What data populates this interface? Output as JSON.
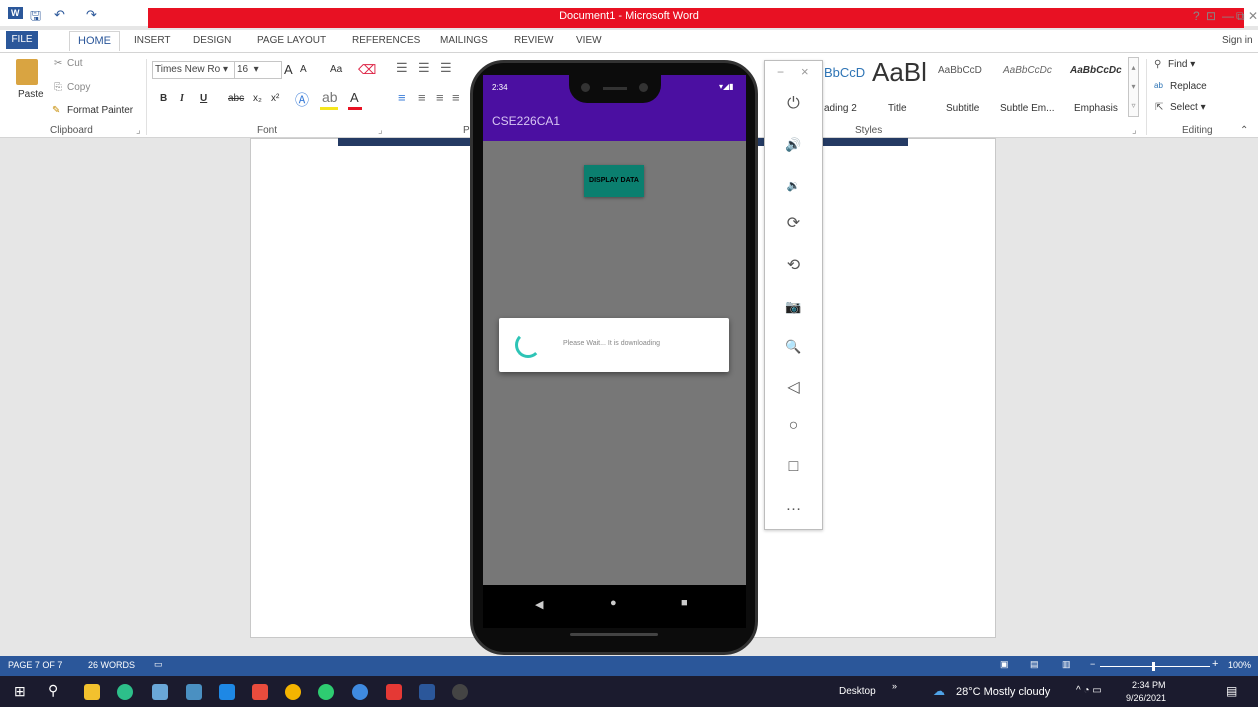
{
  "window": {
    "title": "Document1 - Microsoft Word",
    "controls": [
      "?",
      "⊡",
      "—",
      "⧉",
      "✕"
    ]
  },
  "quick_access": {
    "word_icon": "W",
    "save": "🖫",
    "undo": "↶",
    "redo": "↷"
  },
  "tabs": [
    "FILE",
    "HOME",
    "INSERT",
    "DESIGN",
    "PAGE LAYOUT",
    "REFERENCES",
    "MAILINGS",
    "REVIEW",
    "VIEW"
  ],
  "sign_in": "Sign in",
  "clipboard": {
    "paste": "Paste",
    "cut": "Cut",
    "copy": "Copy",
    "format_painter": "Format Painter",
    "label": "Clipboard"
  },
  "font": {
    "name": "Times New Ro",
    "size": "16",
    "grow": "A",
    "shrink": "A",
    "case": "Aa",
    "bold": "B",
    "italic": "I",
    "underline": "U",
    "strike": "abc",
    "sub": "x₂",
    "sup": "x²",
    "label": "Font"
  },
  "paragraph": {
    "label": "P"
  },
  "styles": {
    "items": [
      {
        "preview": "BbCcD",
        "name": "ading 2"
      },
      {
        "preview": "AaBl",
        "name": "Title"
      },
      {
        "preview": "AaBbCcD",
        "name": "Subtitle"
      },
      {
        "preview": "AaBbCcDc",
        "name": "Subtle Em..."
      },
      {
        "preview": "AaBbCcDc",
        "name": "Emphasis"
      }
    ],
    "label": "Styles"
  },
  "editing": {
    "find": "Find",
    "replace": "Replace",
    "select": "Select",
    "label": "Editing"
  },
  "phone": {
    "time": "2:34",
    "app_title": "CSE226CA1",
    "button": "DISPLAY DATA",
    "dialog_text": "Please Wait... It is downloading",
    "nav": [
      "◀",
      "●",
      "■"
    ]
  },
  "emulator": {
    "min": "−",
    "close": "×",
    "buttons": [
      "⏻",
      "🔊",
      "🔉",
      "⟳",
      "⟲",
      "📷",
      "🔍",
      "◁",
      "○",
      "□",
      "…"
    ]
  },
  "statusbar": {
    "page": "PAGE 7 OF 7",
    "words": "26 WORDS",
    "zoom": "100%"
  },
  "taskbar": {
    "desktop": "Desktop",
    "weather": "28°C  Mostly cloudy",
    "time": "2:34 PM",
    "date": "9/26/2021",
    "chevron": "»"
  },
  "colors": {
    "word_blue": "#2b579a",
    "app_purple": "#4b0fa1",
    "button_teal": "#0b7f6f",
    "spinner": "#2ec4b6"
  }
}
